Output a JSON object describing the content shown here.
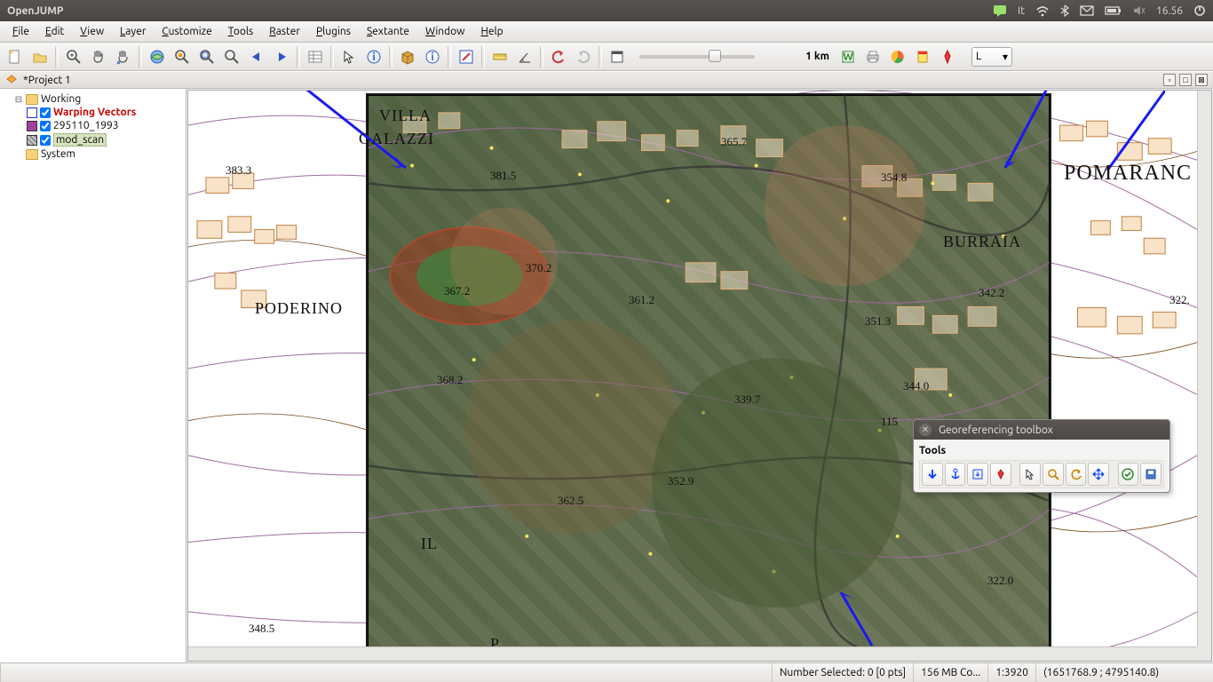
{
  "gnome": {
    "app_title": "OpenJUMP",
    "tray": {
      "lang": "It",
      "time": "16.56"
    }
  },
  "menu": {
    "file": "File",
    "edit": "Edit",
    "view": "View",
    "layer": "Layer",
    "customize": "Customize",
    "tools": "Tools",
    "raster": "Raster",
    "plugins": "Plugins",
    "sextante": "Sextante",
    "window": "Window",
    "help": "Help"
  },
  "toolbar": {
    "scale_label": "1 km",
    "layer_combo": "L"
  },
  "project": {
    "title": "*Project 1"
  },
  "tree": {
    "working": "Working",
    "warping": "Warping Vectors",
    "layer_295110": "295110_1993",
    "mod_scan": "mod_scan",
    "system": "System"
  },
  "map_labels": {
    "villa_galazzi_1": "VILLA",
    "villa_galazzi_2": "GALAZZI",
    "poderino": "PODERINO",
    "pomaranc": "POMARANC",
    "burraia": "BURRAIA",
    "il": "IL",
    "p": "P."
  },
  "elevations": {
    "e383_3": "383.3",
    "e381_5": "381.5",
    "e365_7": "365.7",
    "e354_8": "354.8",
    "e370_2": "370.2",
    "e367_2": "367.2",
    "e361_2": "361.2",
    "e351_3": "351.3",
    "e342_2": "342.2",
    "e322": "322.",
    "e368_2": "368.2",
    "e344_0": "344.0",
    "e339_7": "339.7",
    "e115": "115",
    "e352_9": "352.9",
    "e362_5": "362.5",
    "e322_0": "322.0",
    "e348_5": "348.5"
  },
  "georef": {
    "title": "Georeferencing toolbox",
    "section": "Tools"
  },
  "status": {
    "selected": "Number Selected: 0 [0 pts]",
    "memory": "156 MB Co...",
    "scale": "1:3920",
    "coords": "(1651768.9 ; 4795140.8)"
  }
}
